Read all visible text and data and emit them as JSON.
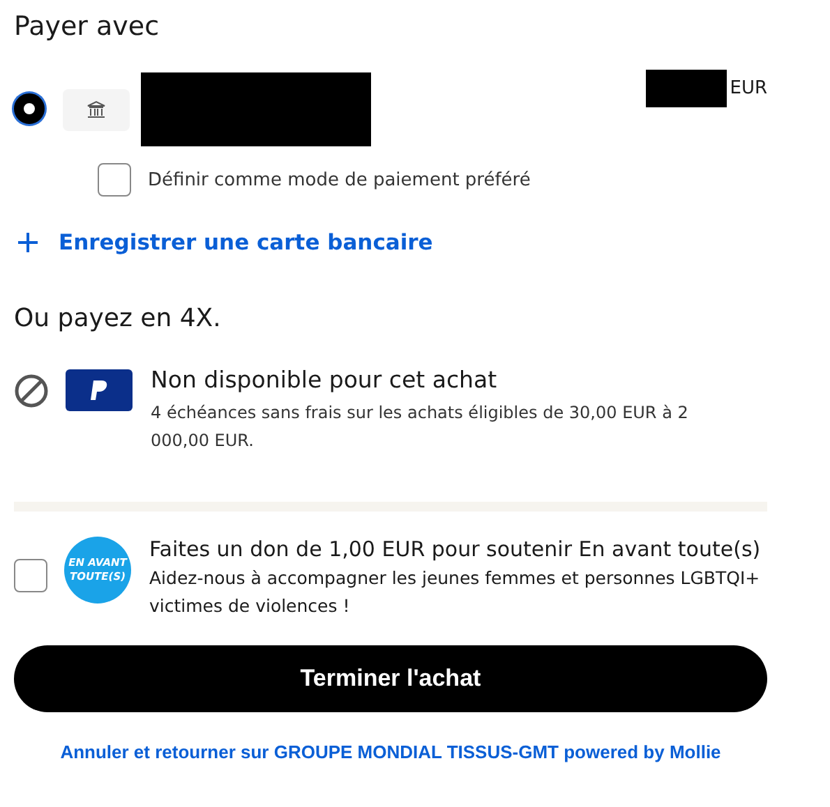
{
  "heading": "Payer avec",
  "saved_method": {
    "selected": true,
    "currency": "EUR",
    "preferred_checkbox": {
      "label": "Définir comme mode de paiement préféré",
      "checked": false
    }
  },
  "add_card_link": "Enregistrer une carte bancaire",
  "installments": {
    "heading": "Ou payez en 4X.",
    "disabled": true,
    "title": "Non disponible pour cet achat",
    "description": "4 échéances sans frais sur les achats éligibles de 30,00 EUR à 2 000,00 EUR."
  },
  "donation": {
    "checked": false,
    "logo_text": [
      "EN AVANT",
      "TOUTE(S)"
    ],
    "title": "Faites un don de 1,00 EUR pour soutenir En avant toute(s)",
    "description": "Aidez-nous à accompagner les jeunes femmes et personnes LGBTQI+ victimes de violences !"
  },
  "submit_button": "Terminer l'achat",
  "footer_link": "Annuler et retourner sur GROUPE MONDIAL TISSUS-GMT powered by Mollie"
}
